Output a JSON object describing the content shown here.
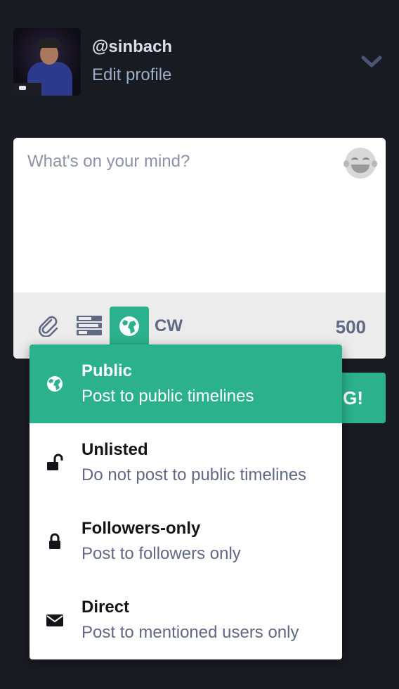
{
  "profile": {
    "username": "@sinbach",
    "edit_label": "Edit profile"
  },
  "composer": {
    "placeholder": "What's on your mind?",
    "cw_label": "CW",
    "char_counter": "500",
    "emoji_icon": "laughing-emoji-icon",
    "toolbar_icons": [
      "paperclip-icon",
      "poll-icon",
      "globe-icon"
    ]
  },
  "toot_button": {
    "visible_label": "G!"
  },
  "privacy_menu": {
    "options": [
      {
        "icon": "globe-icon",
        "title": "Public",
        "description": "Post to public timelines",
        "active": true
      },
      {
        "icon": "unlock-icon",
        "title": "Unlisted",
        "description": "Do not post to public timelines",
        "active": false
      },
      {
        "icon": "lock-icon",
        "title": "Followers-only",
        "description": "Post to followers only",
        "active": false
      },
      {
        "icon": "envelope-icon",
        "title": "Direct",
        "description": "Post to mentioned users only",
        "active": false
      }
    ]
  },
  "colors": {
    "background": "#191b22",
    "accent": "#2bb28c",
    "muted_text": "#606984",
    "link_text": "#9baec8"
  }
}
